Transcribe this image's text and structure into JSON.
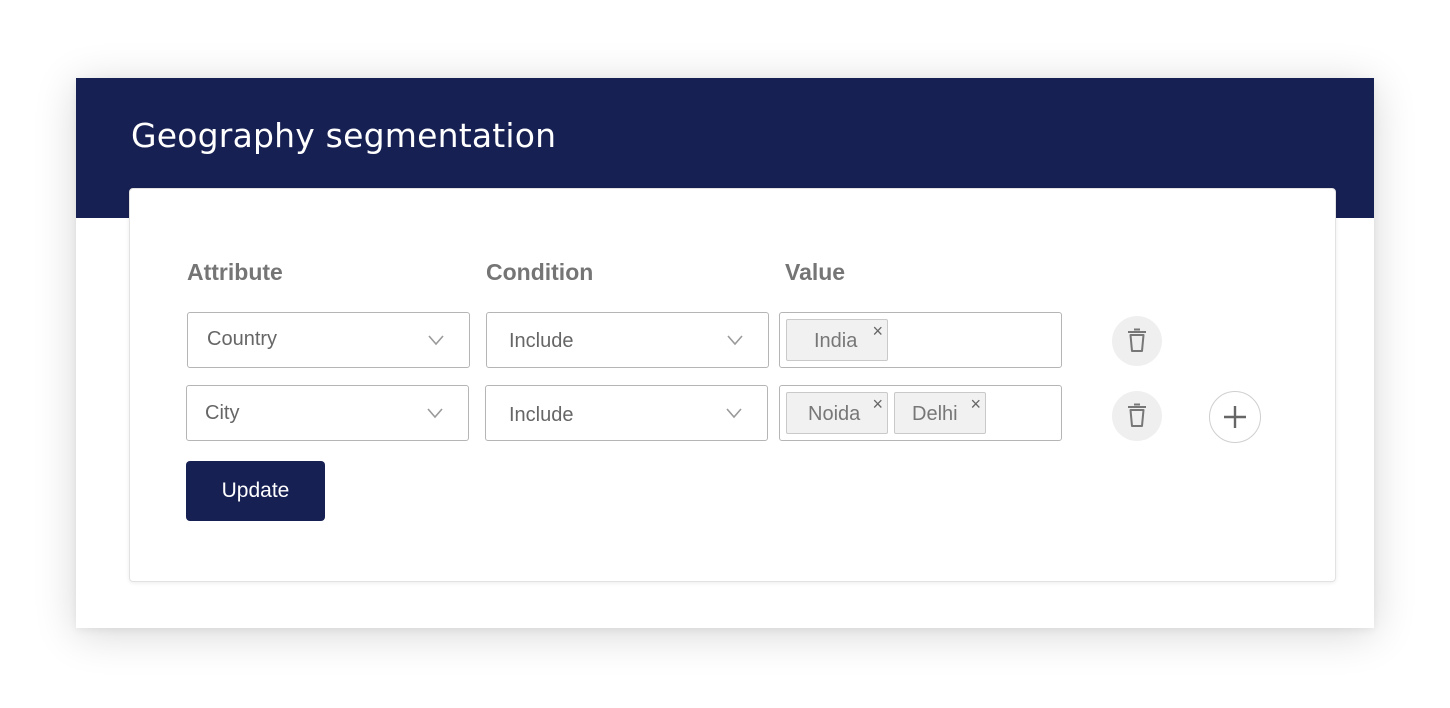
{
  "header": {
    "title": "Geography segmentation"
  },
  "columns": {
    "attribute": "Attribute",
    "condition": "Condition",
    "value": "Value"
  },
  "rows": [
    {
      "attribute": "Country",
      "condition": "Include",
      "values": [
        "India"
      ]
    },
    {
      "attribute": "City",
      "condition": "Include",
      "values": [
        "Noida",
        "Delhi"
      ]
    }
  ],
  "chip_remove_glyph": "×",
  "actions": {
    "update_label": "Update"
  },
  "colors": {
    "brand_navy": "#172052",
    "icon_grey": "#777777"
  },
  "icons": {
    "dropdown": "chevron-down-icon",
    "delete": "trash-icon",
    "add": "plus-icon"
  }
}
